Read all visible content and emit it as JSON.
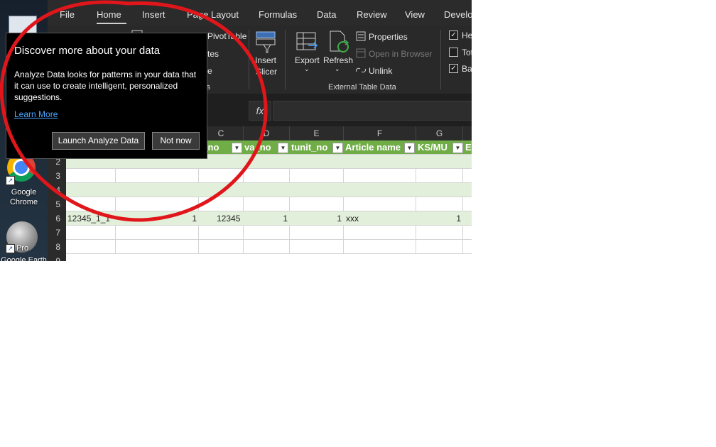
{
  "desktop": {
    "icons": [
      {
        "label": "Fo"
      },
      {
        "label": "Google Chrome"
      },
      {
        "label": "Pro"
      },
      {
        "label": "Google Earth"
      }
    ]
  },
  "ribbon": {
    "tabs": [
      "File",
      "Home",
      "Insert",
      "Page Layout",
      "Formulas",
      "Data",
      "Review",
      "View",
      "Develo"
    ],
    "active_tab": "Home",
    "tools": {
      "pivot_table": "PivotTable",
      "duplicates_partial": "tes",
      "convert_partial": "e",
      "tools_partial": "ls",
      "insert_slicer_line1": "Insert",
      "insert_slicer_line2": "Slicer",
      "export": "Export",
      "refresh": "Refresh",
      "properties": "Properties",
      "open_in_browser": "Open in Browser",
      "unlink": "Unlink",
      "external_group": "External Table Data",
      "header_row_partial": "He",
      "total_row_partial": "Tot",
      "banded_rows_partial": "Ba"
    }
  },
  "formula_bar": {
    "fx": "fx"
  },
  "grid": {
    "columns": [
      "C",
      "D",
      "E",
      "F",
      "G"
    ],
    "row_numbers": [
      "2",
      "3",
      "4",
      "5",
      "6",
      "7",
      "8",
      "9"
    ],
    "headers": [
      "t_no",
      "va_no",
      "tunit_no",
      "Article name",
      "KS/MU",
      "E"
    ],
    "row6": {
      "a": "12345_1_1",
      "b": "1",
      "c": "12345",
      "d": "1",
      "e": "1",
      "f": "xxx",
      "g": "1"
    }
  },
  "popup": {
    "title": "Discover more about your data",
    "body": "Analyze Data looks for patterns in your data that it can use to create intelligent, personalized suggestions.",
    "link": "Learn More",
    "primary_button": "Launch Analyze Data",
    "secondary_button": "Not now"
  },
  "colors": {
    "annotation": "#e0161b",
    "table_header": "#70ad47",
    "band": "#e2efda",
    "link": "#4ea6ff"
  }
}
